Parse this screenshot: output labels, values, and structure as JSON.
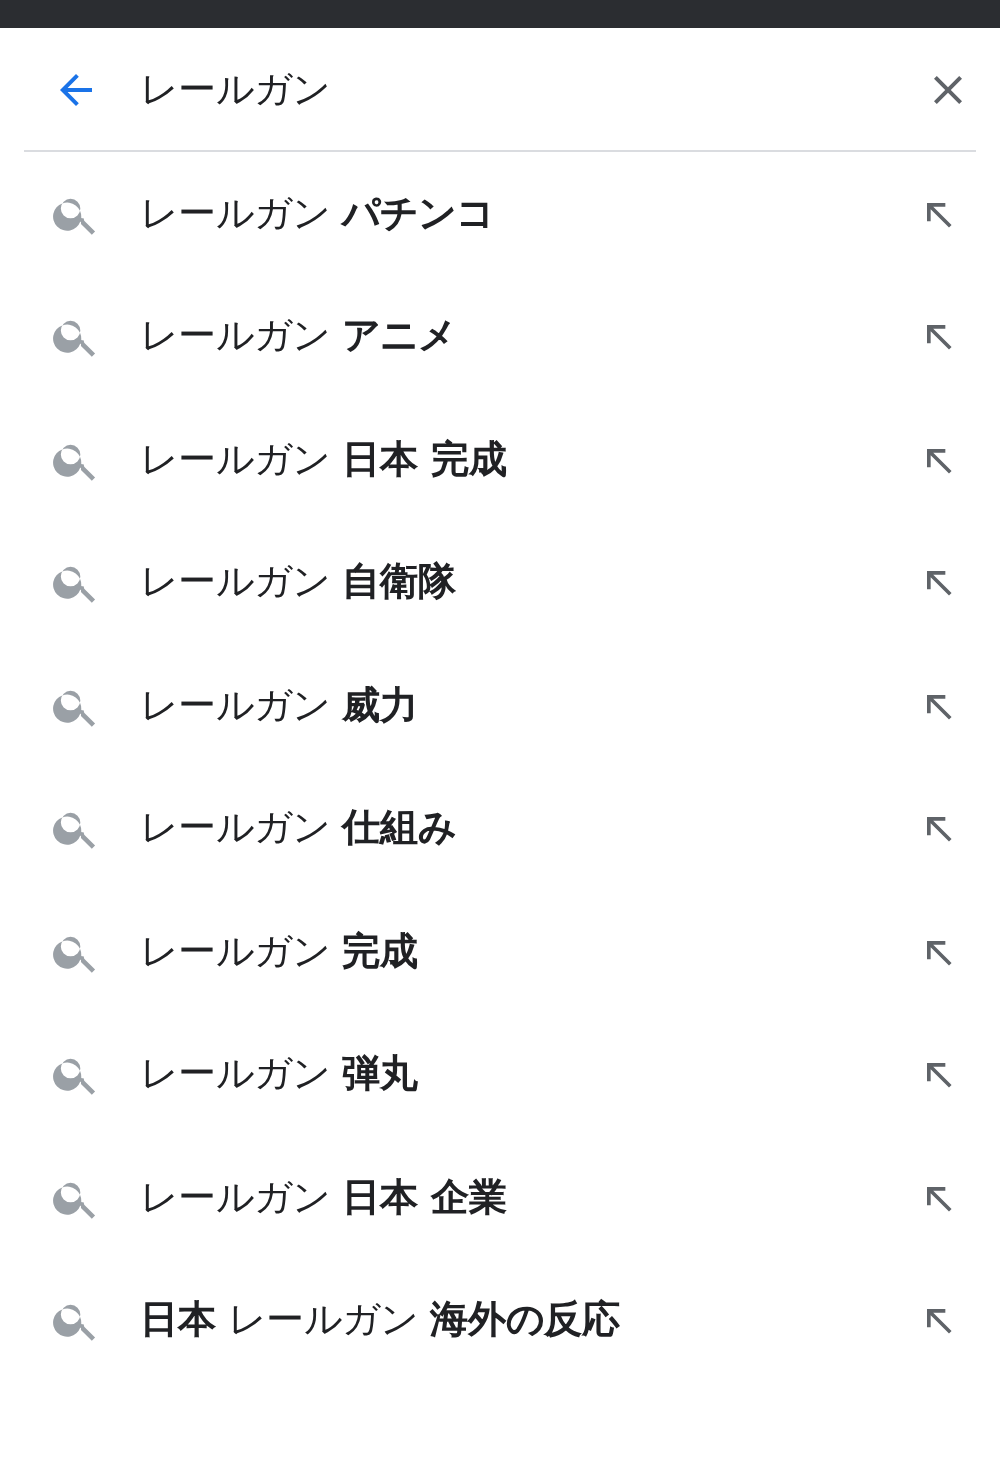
{
  "search": {
    "value": "レールガン"
  },
  "suggestions": [
    {
      "text": "レールガン **パチンコ**"
    },
    {
      "text": "レールガン **アニメ**"
    },
    {
      "text": "レールガン **日本 完成**"
    },
    {
      "text": "レールガン **自衛隊**"
    },
    {
      "text": "レールガン **威力**"
    },
    {
      "text": "レールガン **仕組み**"
    },
    {
      "text": "レールガン **完成**"
    },
    {
      "text": "レールガン **弾丸**"
    },
    {
      "text": "レールガン **日本 企業**"
    },
    {
      "text": "**日本** レールガン **海外の反応**"
    }
  ]
}
